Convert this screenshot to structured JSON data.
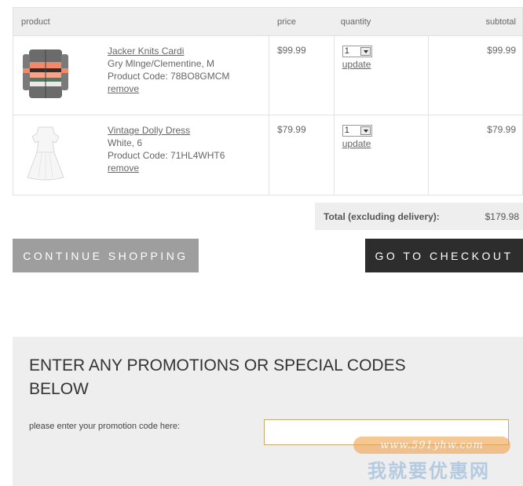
{
  "table": {
    "headers": {
      "product": "product",
      "price": "price",
      "quantity": "quantity",
      "subtotal": "subtotal"
    },
    "rows": [
      {
        "name": "Jacker Knits Cardi",
        "variant": "Gry Mlnge/Clementine, M",
        "code": "Product Code: 78BO8GMCM",
        "remove": "remove",
        "price": "$99.99",
        "qty": "1",
        "update": "update",
        "subtotal": "$99.99",
        "thumb_icon": "striped-cardigan-image"
      },
      {
        "name": "Vintage Dolly Dress",
        "variant": "White, 6",
        "code": "Product Code: 71HL4WHT6",
        "remove": "remove",
        "price": "$79.99",
        "qty": "1",
        "update": "update",
        "subtotal": "$79.99",
        "thumb_icon": "white-dress-image"
      }
    ]
  },
  "total": {
    "label": "Total (excluding delivery):",
    "value": "$179.98"
  },
  "buttons": {
    "continue": "CONTINUE SHOPPING",
    "checkout": "GO TO CHECKOUT"
  },
  "promo": {
    "title": "ENTER ANY PROMOTIONS OR SPECIAL CODES BELOW",
    "label": "please enter your promotion code here:",
    "value": ""
  },
  "watermark": {
    "url": "www.591yhw.com",
    "text": "我就要优惠网"
  },
  "colors": {
    "continue_bg": "#9e9e9e",
    "checkout_bg": "#2d2d2d",
    "header_bg": "#efefef",
    "input_border": "#c9a96b"
  }
}
